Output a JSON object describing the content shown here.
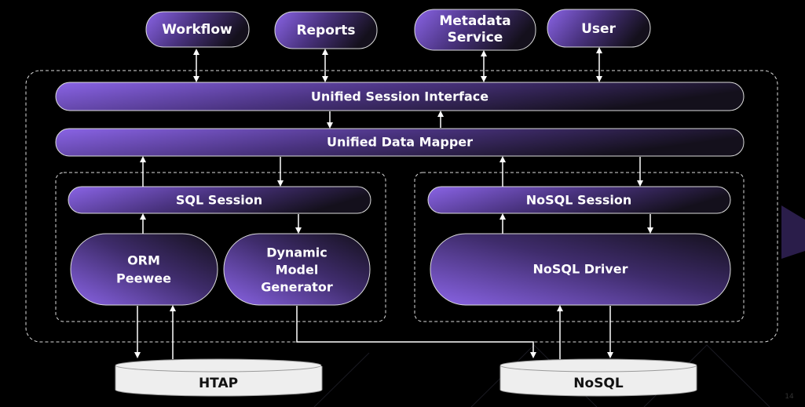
{
  "top_nodes": {
    "workflow": "Workflow",
    "reports": "Reports",
    "metadata_line1": "Metadata",
    "metadata_line2": "Service",
    "user": "User"
  },
  "layers": {
    "unified_session_interface": "Unified Session Interface",
    "unified_data_mapper": "Unified Data Mapper"
  },
  "sql": {
    "session": "SQL Session",
    "orm_line1": "ORM",
    "orm_line2": "Peewee",
    "dmg_line1": "Dynamic",
    "dmg_line2": "Model",
    "dmg_line3": "Generator"
  },
  "nosql": {
    "session": "NoSQL Session",
    "driver": "NoSQL Driver"
  },
  "databases": {
    "htap": "HTAP",
    "nosql": "NoSQL"
  },
  "page_number": "14",
  "colors": {
    "gradient_start": "#8a64e6",
    "gradient_end": "#14101c",
    "background": "#000000",
    "database_fill": "#eeeeee"
  }
}
